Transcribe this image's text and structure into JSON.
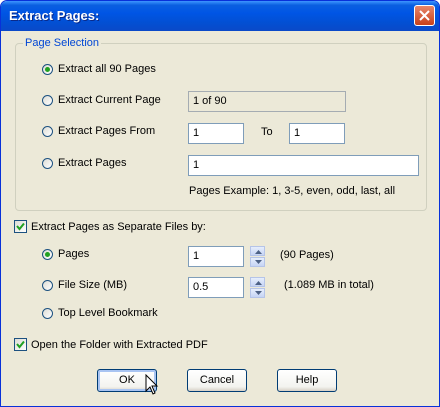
{
  "window": {
    "title": "Extract Pages:"
  },
  "page_selection": {
    "legend": "Page Selection",
    "extract_all_label": "Extract all 90 Pages",
    "extract_current_label": "Extract Current Page",
    "current_page_value": "1 of 90",
    "extract_from_label": "Extract Pages From",
    "from_value": "1",
    "to_label": "To",
    "to_value": "1",
    "extract_pages_label": "Extract Pages",
    "pages_value": "1",
    "pages_example": "Pages Example: 1, 3-5, even, odd, last, all"
  },
  "separate_files": {
    "checkbox_label": "Extract Pages as Separate Files by:",
    "checked": true,
    "pages_label": "Pages",
    "pages_value": "1",
    "pages_note": "(90 Pages)",
    "file_size_label": "File Size (MB)",
    "file_size_value": "0.5",
    "file_size_note": "(1.089 MB in total)",
    "bookmark_label": "Top Level Bookmark"
  },
  "open_folder": {
    "label": "Open the Folder with Extracted PDF",
    "checked": true
  },
  "buttons": {
    "ok": "OK",
    "cancel": "Cancel",
    "help": "Help"
  }
}
